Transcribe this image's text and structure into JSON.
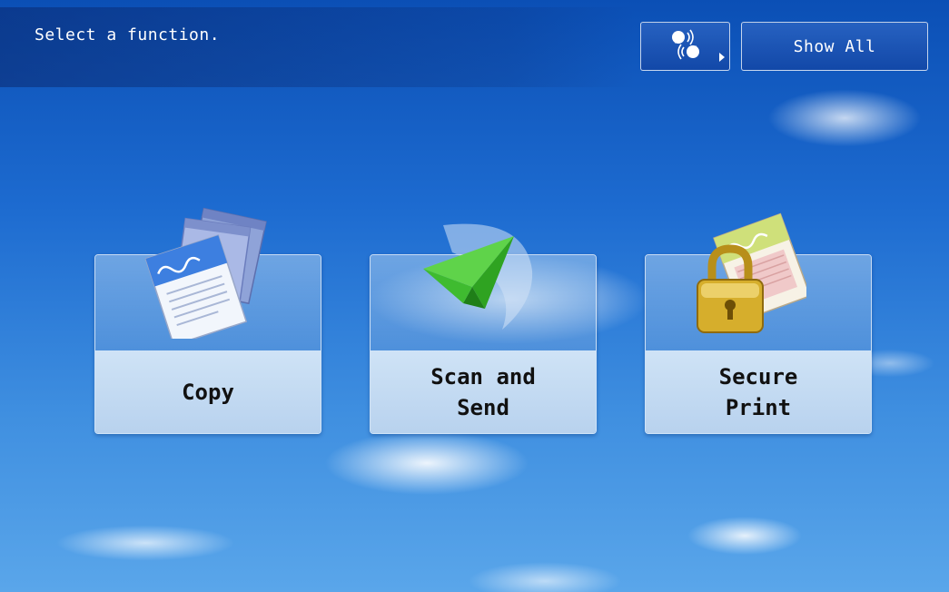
{
  "header": {
    "prompt": "Select a function.",
    "show_all_label": "Show All"
  },
  "functions": [
    {
      "label": "Copy",
      "icon": "copy-documents-icon"
    },
    {
      "label": "Scan and\nSend",
      "icon": "paper-plane-icon"
    },
    {
      "label": "Secure\nPrint",
      "icon": "padlock-document-icon"
    }
  ],
  "icons": {
    "voice": "voice-guidance-icon"
  },
  "colors": {
    "sky_top": "#0b4fb5",
    "sky_bottom": "#5aa6ea",
    "card_label_bg": "#cfe3f6",
    "plane_green": "#2fb52a",
    "lock_gold": "#c9a227"
  }
}
